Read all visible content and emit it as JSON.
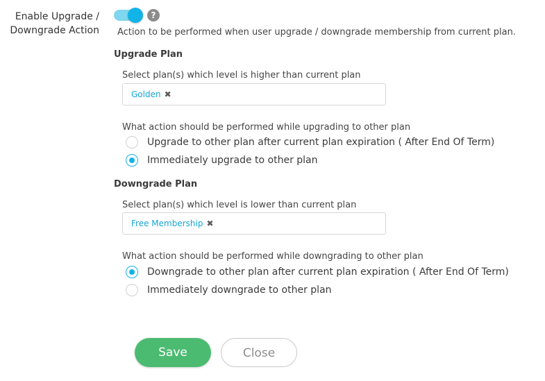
{
  "setting": {
    "label_line1": "Enable Upgrade /",
    "label_line2": "Downgrade Action",
    "toggle_state": "on",
    "help_icon": "question-mark-icon",
    "help_glyph": "?",
    "description": "Action to be performed when user upgrade / downgrade membership from current plan."
  },
  "upgrade": {
    "heading": "Upgrade Plan",
    "select_label": "Select plan(s) which level is higher than current plan",
    "selected_chips": [
      {
        "label": "Golden",
        "remove_glyph": "✖"
      }
    ],
    "action_label": "What action should be performed while upgrading to other plan",
    "options": [
      {
        "label": "Upgrade to other plan after current plan expiration ( After End Of Term)",
        "checked": false
      },
      {
        "label": "Immediately upgrade to other plan",
        "checked": true
      }
    ]
  },
  "downgrade": {
    "heading": "Downgrade Plan",
    "select_label": "Select plan(s) which level is lower than current plan",
    "selected_chips": [
      {
        "label": "Free Membership",
        "remove_glyph": "✖"
      }
    ],
    "action_label": "What action should be performed while downgrading to other plan",
    "options": [
      {
        "label": "Downgrade to other plan after current plan expiration ( After End Of Term)",
        "checked": true
      },
      {
        "label": "Immediately downgrade to other plan",
        "checked": false
      }
    ]
  },
  "actions": {
    "save_label": "Save",
    "close_label": "Close"
  },
  "colors": {
    "accent": "#12b3e6",
    "toggle_track": "#7fd7ef",
    "save_button": "#4cbb72",
    "chip_text": "#14a6d6"
  }
}
